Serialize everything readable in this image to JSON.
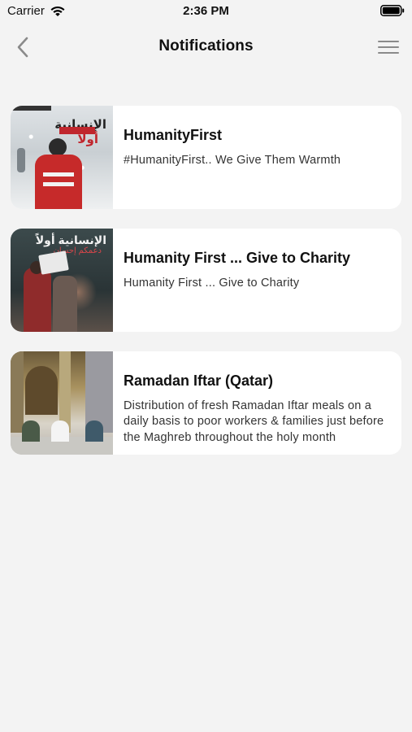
{
  "status_bar": {
    "carrier": "Carrier",
    "time": "2:36 PM",
    "wifi_icon": "wifi-icon",
    "battery_icon": "battery-full-icon"
  },
  "nav": {
    "title": "Notifications",
    "back_icon": "chevron-left-icon",
    "menu_icon": "hamburger-menu-icon"
  },
  "notifications": [
    {
      "title": "HumanityFirst",
      "text": "#HumanityFirst.. We Give Them Warmth",
      "thumb_text_1": "الإنسانية",
      "thumb_text_2": "أولاً"
    },
    {
      "title": "Humanity First ... Give to Charity",
      "text": "Humanity First ... Give to Charity",
      "thumb_text_1": "الإنسانية أولاً",
      "thumb_text_2": "دعمكم إحسان"
    },
    {
      "title": "Ramadan Iftar (Qatar)",
      "text": "Distribution of fresh Ramadan Iftar meals on a daily basis to poor workers & families just before the Maghreb throughout the holy month"
    }
  ],
  "colors": {
    "background": "#f3f3f3",
    "card": "#ffffff",
    "accent_red": "#c62a2a",
    "menu_icon": "#8a8a8a"
  }
}
